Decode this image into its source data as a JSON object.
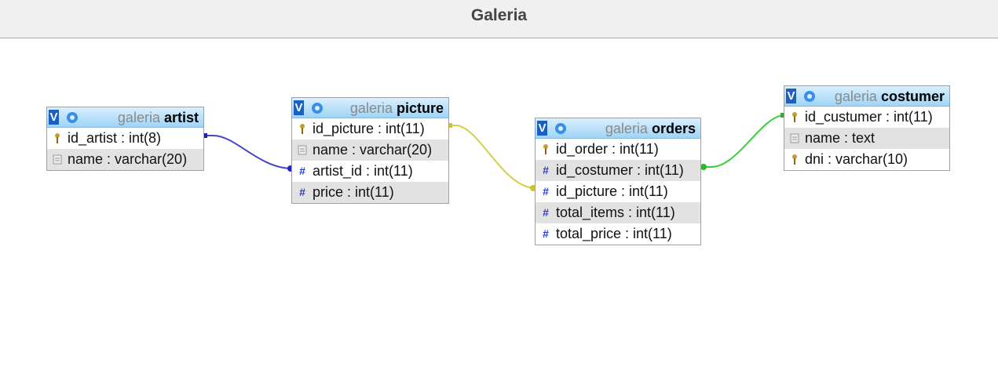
{
  "page": {
    "title": "Galeria"
  },
  "colors": {
    "artist_picture_link": "#4444cc",
    "picture_orders_link": "#d4d04a",
    "orders_costumer_link": "#3ccf3c"
  },
  "tables": {
    "artist": {
      "db": "galeria",
      "name": "artist",
      "toggle": "V",
      "columns": [
        {
          "label": "id_artist : int(8)",
          "icon": "key-icon"
        },
        {
          "label": "name : varchar(20)",
          "icon": "text-field-icon"
        }
      ]
    },
    "picture": {
      "db": "galeria",
      "name": "picture",
      "toggle": "V",
      "columns": [
        {
          "label": "id_picture : int(11)",
          "icon": "key-icon"
        },
        {
          "label": "name : varchar(20)",
          "icon": "text-field-icon"
        },
        {
          "label": "artist_id : int(11)",
          "icon": "hash-icon"
        },
        {
          "label": "price : int(11)",
          "icon": "hash-icon"
        }
      ]
    },
    "orders": {
      "db": "galeria",
      "name": "orders",
      "toggle": "V",
      "columns": [
        {
          "label": "id_order : int(11)",
          "icon": "key-icon"
        },
        {
          "label": "id_costumer : int(11)",
          "icon": "hash-icon"
        },
        {
          "label": "id_picture : int(11)",
          "icon": "hash-icon"
        },
        {
          "label": "total_items : int(11)",
          "icon": "hash-icon"
        },
        {
          "label": "total_price : int(11)",
          "icon": "hash-icon"
        }
      ]
    },
    "costumer": {
      "db": "galeria",
      "name": "costumer",
      "toggle": "V",
      "columns": [
        {
          "label": "id_custumer : int(11)",
          "icon": "key-icon"
        },
        {
          "label": "name : text",
          "icon": "text-field-icon"
        },
        {
          "label": "dni : varchar(10)",
          "icon": "key-icon"
        }
      ]
    }
  }
}
